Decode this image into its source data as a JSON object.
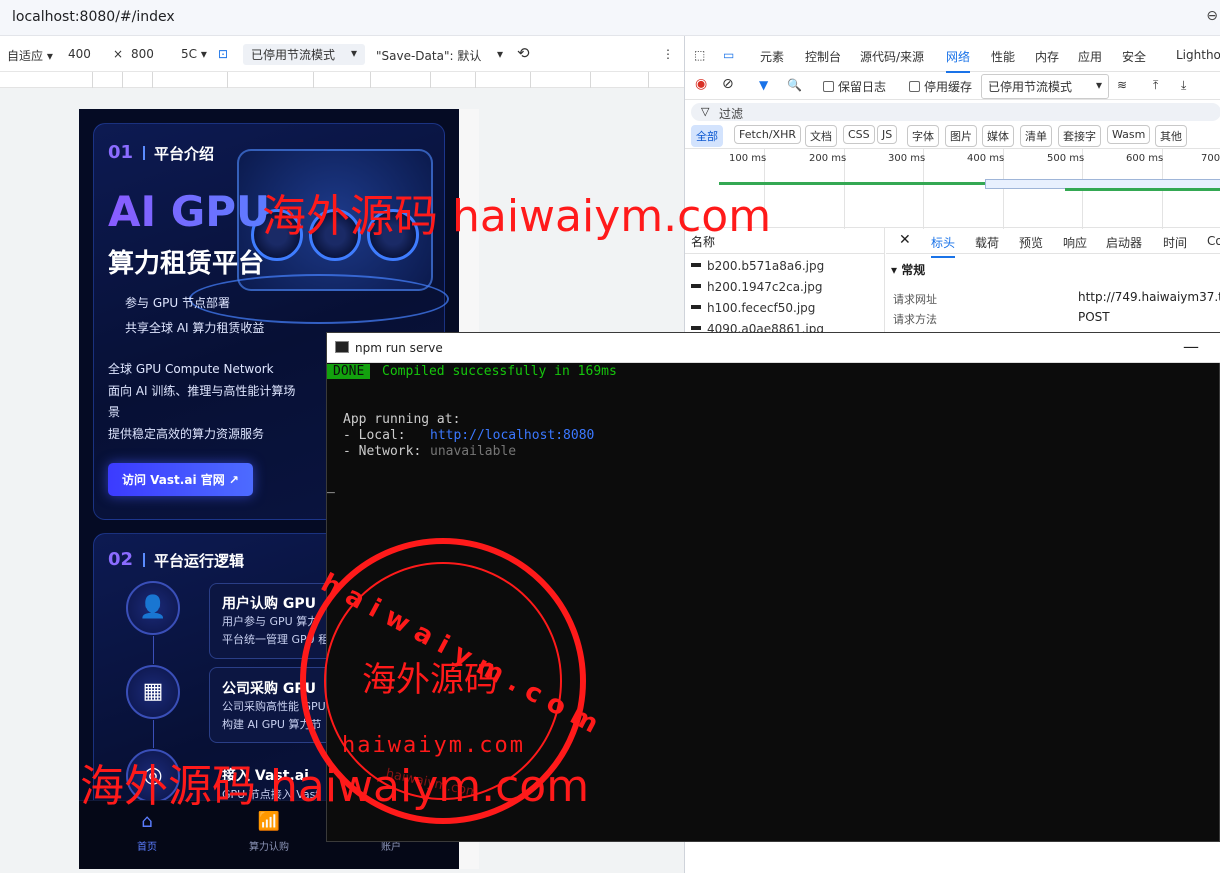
{
  "browser": {
    "url": "localhost:8080/#/index"
  },
  "device_toolbar": {
    "device": "自适应",
    "width": "400",
    "times": "×",
    "height": "800",
    "zoom": "5C",
    "throttle": "已停用节流模式",
    "save_data": "\"Save-Data\": 默认"
  },
  "mobile": {
    "section1": {
      "num": "01",
      "title": "平台介绍",
      "hero_ai": "AI GPU",
      "hero_sub": "算力租赁平台",
      "bullet1": "参与 GPU 节点部署",
      "bullet2": "共享全球 AI 算力租赁收益",
      "line1": "全球 GPU Compute Network",
      "line2": "面向 AI 训练、推理与高性能计算场",
      "line3": "景",
      "line4": "提供稳定高效的算力资源服务",
      "button": "访问 Vast.ai 官网 ↗"
    },
    "section2": {
      "num": "02",
      "title": "平台运行逻辑",
      "steps": [
        {
          "icon": "user-icon",
          "title": "用户认购 GPU",
          "desc1": "用户参与 GPU 算力",
          "desc2": "平台统一管理 GPU 租"
        },
        {
          "icon": "building-icon",
          "title": "公司采购 GPU",
          "desc1": "公司采购高性能 GPU",
          "desc2": "构建 AI GPU 算力节"
        },
        {
          "icon": "link-icon",
          "title": "接入 Vast.ai",
          "desc1": "GPU 节点接入 Vast",
          "desc2": ""
        }
      ]
    },
    "tabbar": [
      {
        "icon": "home-icon",
        "label": "首页"
      },
      {
        "icon": "chart-icon",
        "label": "算力认购"
      },
      {
        "icon": "account-icon",
        "label": "账户"
      }
    ]
  },
  "devtools": {
    "tabs": [
      "元素",
      "控制台",
      "源代码/来源",
      "网络",
      "性能",
      "内存",
      "应用",
      "安全",
      "Lightho"
    ],
    "active_tab": "网络",
    "preserve_log": "保留日志",
    "disable_cache": "停用缓存",
    "throttle": "已停用节流模式",
    "filter_placeholder": "过滤",
    "types": [
      "全部",
      "Fetch/XHR",
      "文档",
      "CSS",
      "JS",
      "字体",
      "图片",
      "媒体",
      "清单",
      "套接字",
      "Wasm",
      "其他"
    ],
    "timeline_ticks": [
      "100 ms",
      "200 ms",
      "300 ms",
      "400 ms",
      "500 ms",
      "600 ms",
      "700"
    ],
    "name_header": "名称",
    "requests": [
      "b200.b571a8a6.jpg",
      "h200.1947c2ca.jpg",
      "h100.fececf50.jpg",
      "4090.a0ae8861.jpg"
    ],
    "detail_tabs": [
      "标头",
      "载荷",
      "预览",
      "响应",
      "启动器",
      "时间",
      "Co"
    ],
    "general_label": "▾ 常规",
    "request_url_label": "请求网址",
    "request_url_value": "http://749.haiwaiym37.tc",
    "request_method_label": "请求方法",
    "request_method_value": "POST"
  },
  "terminal": {
    "title": "npm run serve",
    "done_badge": "DONE",
    "compiled": "Compiled successfully in 169ms",
    "running": "App running at:",
    "local_label": "- Local:   ",
    "local_url": "http://localhost:8080",
    "network_label": "- Network: ",
    "network_value": "unavailable",
    "cursor": "_"
  },
  "watermarks": {
    "top": "海外源码 haiwaiym.com",
    "bottom": "海外源码 haiwaiym.com",
    "stamp_ring": "h a i w a i y m . c o m",
    "stamp_center": "海外源码",
    "stamp_bottom": "haiwaiym.com",
    "stamp_faint": "haiwaiym.com"
  },
  "colors": {
    "accent": "#1a73e8",
    "stamp": "#ff1a1a",
    "hero_gradient_start": "#8a5cff",
    "terminal_green": "#16c60c"
  }
}
